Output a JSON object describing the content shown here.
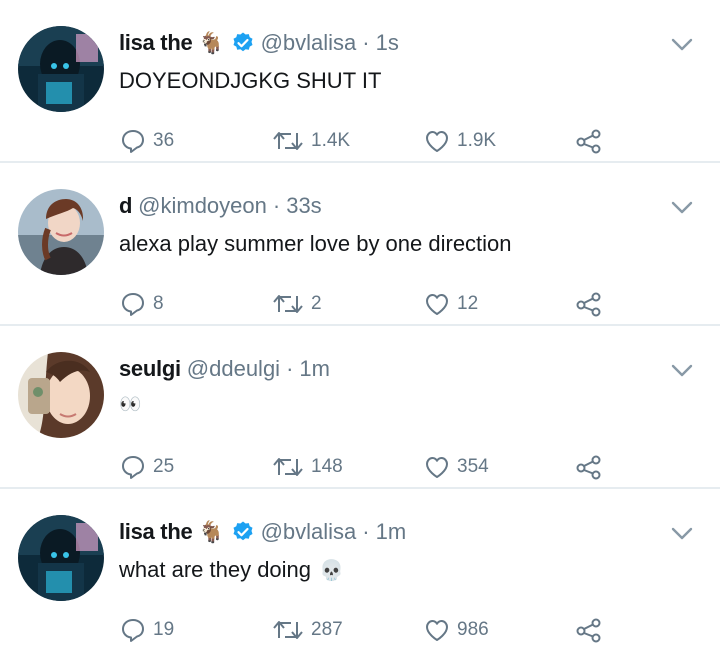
{
  "tweets": [
    {
      "name": "lisa the",
      "has_goat_emoji": true,
      "verified": true,
      "handle": "@bvlalisa",
      "time": "1s",
      "text": "DOYEONDJGKG SHUT IT",
      "replies": "36",
      "retweets": "1.4K",
      "likes": "1.9K",
      "avatar": "lisa-avatar"
    },
    {
      "name": "d",
      "has_goat_emoji": false,
      "verified": false,
      "handle": "@kimdoyeon",
      "time": "33s",
      "text": "alexa play summer love by one direction",
      "replies": "8",
      "retweets": "2",
      "likes": "12",
      "avatar": "doyeon-avatar"
    },
    {
      "name": "seulgi",
      "has_goat_emoji": false,
      "verified": false,
      "handle": "@ddeulgi",
      "time": "1m",
      "text": "",
      "text_emoji": "👀",
      "replies": "25",
      "retweets": "148",
      "likes": "354",
      "avatar": "seulgi-avatar"
    },
    {
      "name": "lisa the",
      "has_goat_emoji": true,
      "verified": true,
      "handle": "@bvlalisa",
      "time": "1m",
      "text": "what are they doing",
      "text_emoji": "💀",
      "replies": "19",
      "retweets": "287",
      "likes": "986",
      "avatar": "lisa-avatar"
    }
  ],
  "goat_emoji": "🐐",
  "colors": {
    "verified_blue": "#1da1f2",
    "secondary_text": "#657786",
    "divider": "#e6ecf0"
  },
  "icons": [
    "reply-icon",
    "retweet-icon",
    "like-icon",
    "share-icon",
    "chevron-down-icon",
    "verified-badge-icon"
  ]
}
